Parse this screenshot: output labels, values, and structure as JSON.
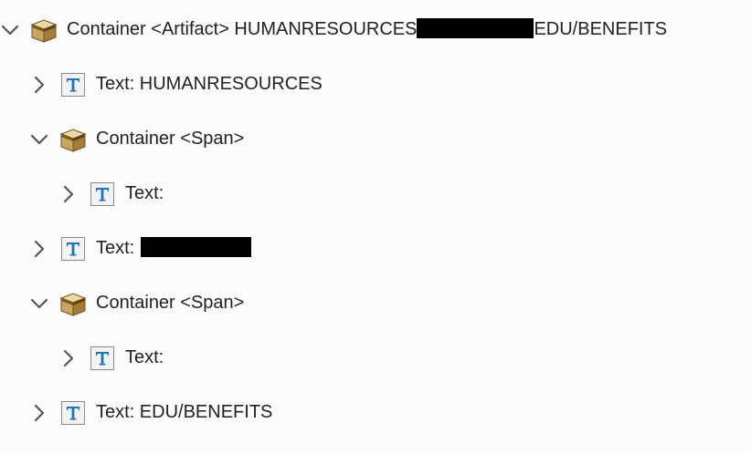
{
  "colors": {
    "background": "#fbfbfb",
    "text": "#222222",
    "chevron": "#555555",
    "redaction": "#000000",
    "text_icon_letter": "#1c73c4"
  },
  "icons": {
    "expanded": "chevron-down-icon",
    "collapsed": "chevron-right-icon",
    "container": "container-box-icon",
    "text": "text-element-icon"
  },
  "tree": {
    "root": {
      "prefix": "Container <Artifact> HUMANRESOURCES",
      "suffix": "EDU/BENEFITS"
    },
    "node_hr": {
      "label": "Text: HUMANRESOURCES"
    },
    "span_1": {
      "label": "Container <Span>",
      "child": {
        "label": "Text:"
      }
    },
    "node_redacted": {
      "label": "Text:"
    },
    "span_2": {
      "label": "Container <Span>",
      "child": {
        "label": "Text:"
      }
    },
    "node_edu": {
      "label": "Text: EDU/BENEFITS"
    }
  }
}
